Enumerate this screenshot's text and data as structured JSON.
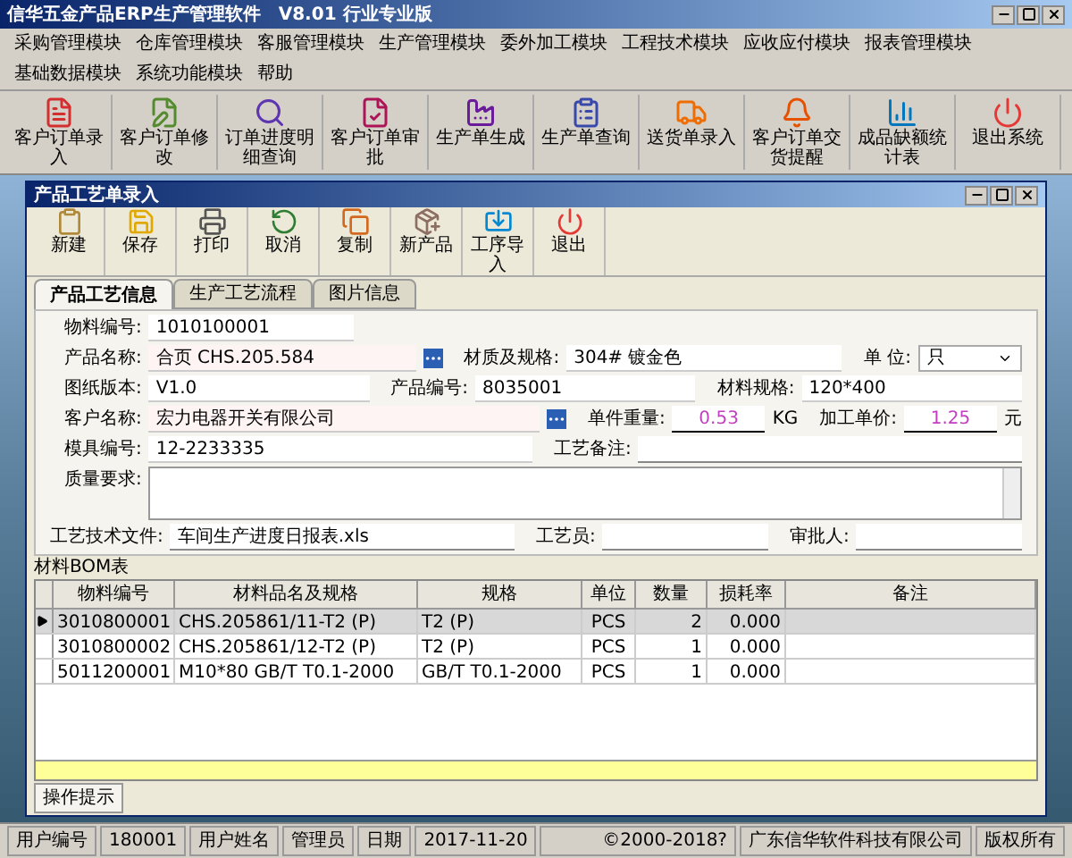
{
  "window": {
    "title": "信华五金产品ERP生产管理软件　V8.01 行业专业版"
  },
  "menu": [
    "采购管理模块",
    "仓库管理模块",
    "客服管理模块",
    "生产管理模块",
    "委外加工模块",
    "工程技术模块",
    "应收应付模块",
    "报表管理模块",
    "基础数据模块",
    "系统功能模块",
    "帮助"
  ],
  "toolbar": [
    "客户订单录入",
    "客户订单修改",
    "订单进度明细查询",
    "客户订单审批",
    "生产单生成",
    "生产单查询",
    "送货单录入",
    "客户订单交货提醒",
    "成品缺额统计表",
    "退出系统"
  ],
  "dialog": {
    "title": "产品工艺单录入",
    "toolbar": [
      "新建",
      "保存",
      "打印",
      "取消",
      "复制",
      "新产品",
      "工序导入",
      "退出"
    ],
    "tabs": [
      {
        "label": "产品工艺信息",
        "selected": true
      },
      {
        "label": "生产工艺流程",
        "selected": false
      },
      {
        "label": "图片信息",
        "selected": false
      }
    ],
    "form_rows": [
      [
        {
          "label": "物料编号:",
          "value": "1010100001",
          "kind": "text"
        }
      ],
      [
        {
          "label": "产品名称:",
          "value": "合页 CHS.205.584",
          "kind": "lookup"
        },
        {
          "label": "材质及规格:",
          "value": "304# 镀金色",
          "kind": "text"
        },
        {
          "label": "单 位:",
          "value": "只",
          "kind": "select"
        }
      ],
      [
        {
          "label": "图纸版本:",
          "value": "V1.0",
          "kind": "text"
        },
        {
          "label": "产品编号:",
          "value": "8035001",
          "kind": "text"
        },
        {
          "label": "材料规格:",
          "value": "120*400",
          "kind": "text"
        }
      ],
      [
        {
          "label": "客户名称:",
          "value": "宏力电器开关有限公司",
          "kind": "lookup"
        },
        {
          "label": "单件重量:",
          "value": "0.53",
          "unit": "KG",
          "kind": "number"
        },
        {
          "label": "加工单价:",
          "value": "1.25",
          "unit": "元",
          "kind": "number"
        }
      ],
      [
        {
          "label": "模具编号:",
          "value": "12-2233335",
          "kind": "text"
        },
        {
          "label": "工艺备注:",
          "kind": "line"
        }
      ]
    ],
    "quality": {
      "label": "质量要求:"
    },
    "file_row": [
      {
        "label": "工艺技术文件:",
        "value": "车间生产进度日报表.xls",
        "kind": "line"
      },
      {
        "label": "工艺员:",
        "kind": "line"
      },
      {
        "label": "审批人:",
        "kind": "line"
      }
    ],
    "bom": {
      "title": "材料BOM表",
      "columns": [
        "物料编号",
        "材料品名及规格",
        "规格",
        "单位",
        "数量",
        "损耗率",
        "备注"
      ],
      "rows": [
        {
          "selected": true,
          "cells": [
            "3010800001",
            "CHS.205861/11-T2 (P)",
            "T2 (P)",
            "PCS",
            "2",
            "0.000",
            ""
          ]
        },
        {
          "selected": false,
          "cells": [
            "3010800002",
            "CHS.205861/12-T2 (P)",
            "T2 (P)",
            "PCS",
            "1",
            "0.000",
            ""
          ]
        },
        {
          "selected": false,
          "cells": [
            "5011200001",
            "M10*80 GB/T T0.1-2000",
            "GB/T T0.1-2000",
            "PCS",
            "1",
            "0.000",
            ""
          ]
        }
      ]
    },
    "hint_tab": "操作提示"
  },
  "status_bar": [
    "用户编号",
    "180001",
    "用户姓名",
    "管理员",
    "日期",
    "2017-11-20",
    "©2000-2018?",
    "广东信华软件科技有限公司",
    "版权所有"
  ]
}
